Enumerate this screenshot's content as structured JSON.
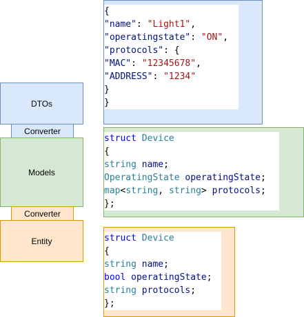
{
  "left_stack": {
    "dtos": "DTOs",
    "converter_top": "Converter",
    "models": "Models",
    "converter_bottom": "Converter",
    "entity": "Entity"
  },
  "dto_json": {
    "lines": [
      [
        {
          "c": "p",
          "t": "{"
        }
      ],
      [
        {
          "c": "v",
          "t": "\"name\""
        },
        {
          "c": "p",
          "t": ": "
        },
        {
          "c": "s",
          "t": "\"Light1\""
        },
        {
          "c": "p",
          "t": ","
        }
      ],
      [
        {
          "c": "v",
          "t": "\"operatingstate\""
        },
        {
          "c": "p",
          "t": ": "
        },
        {
          "c": "s",
          "t": "\"ON\""
        },
        {
          "c": "p",
          "t": ","
        }
      ],
      [
        {
          "c": "v",
          "t": "\"protocols\""
        },
        {
          "c": "p",
          "t": ": {"
        }
      ],
      [
        {
          "c": "v",
          "t": "\"MAC\""
        },
        {
          "c": "p",
          "t": ": "
        },
        {
          "c": "s",
          "t": "\"12345678\""
        },
        {
          "c": "p",
          "t": ","
        }
      ],
      [
        {
          "c": "v",
          "t": "\"ADDRESS\""
        },
        {
          "c": "p",
          "t": ": "
        },
        {
          "c": "s",
          "t": "\"1234\""
        }
      ],
      [
        {
          "c": "p",
          "t": "}"
        }
      ],
      [
        {
          "c": "p",
          "t": "}"
        }
      ]
    ]
  },
  "model_struct": {
    "lines": [
      [
        {
          "c": "k",
          "t": "struct"
        },
        {
          "c": "p",
          "t": " "
        },
        {
          "c": "t",
          "t": "Device"
        }
      ],
      [
        {
          "c": "p",
          "t": "{"
        }
      ],
      [
        {
          "c": "t",
          "t": "string"
        },
        {
          "c": "p",
          "t": " "
        },
        {
          "c": "v",
          "t": "name"
        },
        {
          "c": "p",
          "t": ";"
        }
      ],
      [
        {
          "c": "t",
          "t": "OperatingState"
        },
        {
          "c": "p",
          "t": " "
        },
        {
          "c": "v",
          "t": "operatingState"
        },
        {
          "c": "p",
          "t": ";"
        }
      ],
      [
        {
          "c": "t",
          "t": "map"
        },
        {
          "c": "p",
          "t": "<"
        },
        {
          "c": "t",
          "t": "string"
        },
        {
          "c": "p",
          "t": ", "
        },
        {
          "c": "t",
          "t": "string"
        },
        {
          "c": "p",
          "t": "> "
        },
        {
          "c": "v",
          "t": "protocols"
        },
        {
          "c": "p",
          "t": ";"
        }
      ],
      [
        {
          "c": "p",
          "t": "};"
        }
      ]
    ]
  },
  "entity_struct": {
    "lines": [
      [
        {
          "c": "k",
          "t": "struct"
        },
        {
          "c": "p",
          "t": " "
        },
        {
          "c": "t",
          "t": "Device"
        }
      ],
      [
        {
          "c": "p",
          "t": "{"
        }
      ],
      [
        {
          "c": "t",
          "t": "string"
        },
        {
          "c": "p",
          "t": " "
        },
        {
          "c": "v",
          "t": "name"
        },
        {
          "c": "p",
          "t": ";"
        }
      ],
      [
        {
          "c": "k",
          "t": "bool"
        },
        {
          "c": "p",
          "t": " "
        },
        {
          "c": "v",
          "t": "operatingState"
        },
        {
          "c": "p",
          "t": ";"
        }
      ],
      [
        {
          "c": "t",
          "t": "string"
        },
        {
          "c": "p",
          "t": " "
        },
        {
          "c": "v",
          "t": "protocols"
        },
        {
          "c": "p",
          "t": ";"
        }
      ],
      [
        {
          "c": "p",
          "t": "};"
        }
      ]
    ]
  },
  "colors": {
    "dto_fill": "#dae8fc",
    "dto_stroke": "#6c8ebf",
    "model_fill": "#d5e8d4",
    "model_stroke": "#82b366",
    "entity_fill": "#ffe6cc",
    "entity_stroke": "#d79b00",
    "keyword": "#0000ff",
    "type": "#267f99",
    "variable": "#001080",
    "string": "#a31515"
  }
}
